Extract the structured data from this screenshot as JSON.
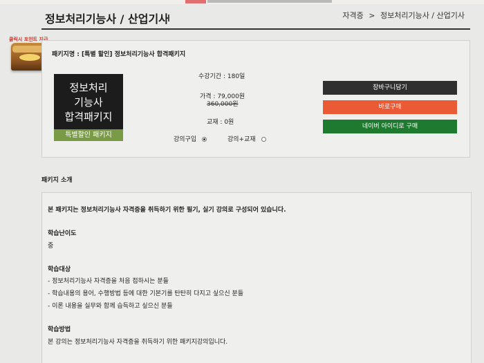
{
  "header": {
    "title": "정보처리기능사 / 산업기사",
    "breadcrumb": [
      "자격증",
      ">",
      "정보처리기능사 / 산업기사"
    ]
  },
  "badge": {
    "ribbon": "클릭시 포인트 지급"
  },
  "package": {
    "name": "패키지명 : [특별 할인] 정보처리기능사 합격패키지",
    "thumb_lines": [
      "정보처리",
      "기능사",
      "합격패키지"
    ],
    "thumb_tag": "특별할인 패키지",
    "period": "수강기간 : 180일",
    "price": "가격 : 79,000원",
    "original_price": "360,000원",
    "textbook": "교재 : 0원",
    "option_lecture": "강의구입",
    "option_lecture_book": "강의+교재",
    "buttons": {
      "cart": "장바구니담기",
      "buy_now": "바로구매",
      "naver": "네이버 아이디로 구매"
    }
  },
  "intro": {
    "section_title": "패키지 소개",
    "summary": "본 패키지는 정보처리기능사 자격증을 취득하기 위한 필기, 실기 강의로 구성되어 있습니다.",
    "difficulty_title": "학습난이도",
    "difficulty_value": "중",
    "target_title": "학습대상",
    "targets": [
      "- 정보처리기능사 자격증을 처음 접하시는 분들",
      "- 학습내용의 용어, 수행방법 등에 대한 기본기를 탄탄히 다지고 싶으신 분들",
      "- 이론 내용을 실무와 함께 습득하고 싶으신 분들"
    ],
    "method_title": "학습방법",
    "method_value": "본 강의는 정보처리기능사 자격증을 취득하기 위한 패키지강의입니다."
  }
}
